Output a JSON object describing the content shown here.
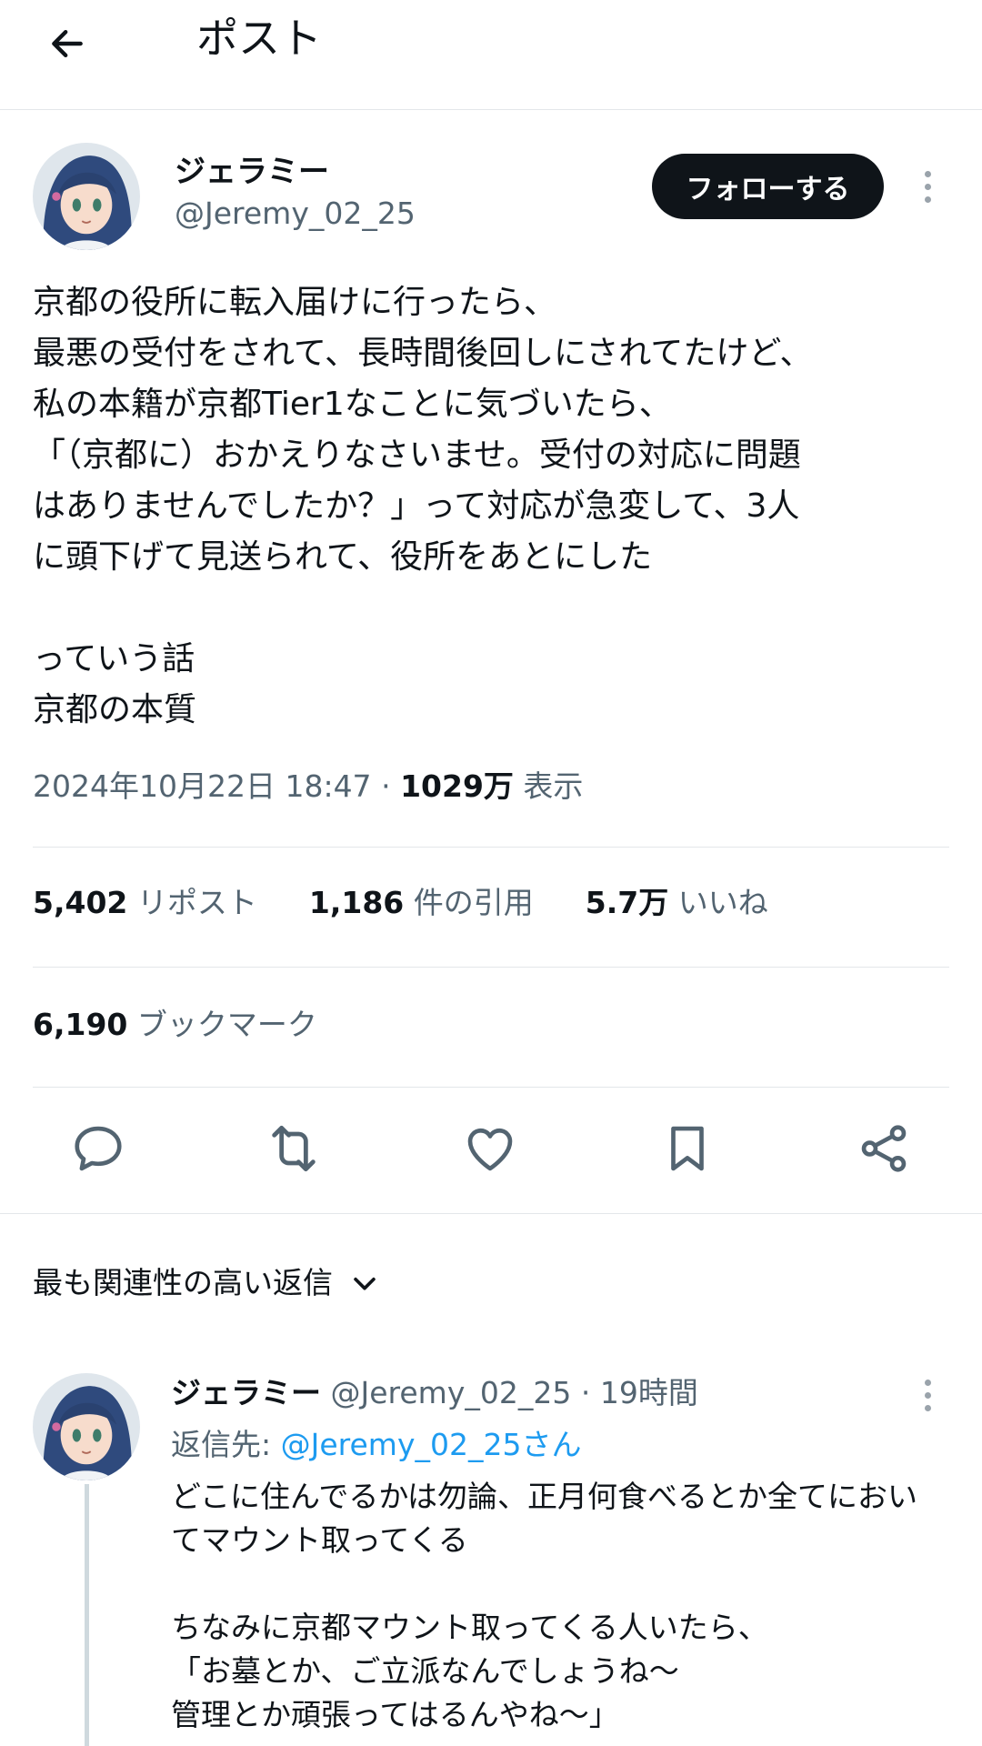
{
  "header": {
    "title": "ポスト",
    "back_icon": "arrow-left-icon"
  },
  "post": {
    "author": {
      "name": "ジェラミー",
      "handle": "@Jeremy_02_25"
    },
    "follow_label": "フォローする",
    "lines": [
      "京都の役所に転入届けに行ったら、",
      "最悪の受付をされて、長時間後回しにされてたけど、",
      "私の本籍が京都Tier1なことに気づいたら、",
      "「（京都に）おかえりなさいませ。受付の対応に問題",
      "はありませんでしたか？」って対応が急変して、3人",
      "に頭下げて見送られて、役所をあとにした",
      "",
      "っていう話",
      "京都の本質"
    ],
    "timestamp": "2024年10月22日 18:47",
    "separator": "·",
    "views_count": "1029万",
    "views_label": "表示",
    "stats": {
      "reposts": "5,402",
      "reposts_label": "リポスト",
      "quotes": "1,186",
      "quotes_label": "件の引用",
      "likes": "5.7万",
      "likes_label": "いいね",
      "bookmarks": "6,190",
      "bookmarks_label": "ブックマーク"
    },
    "actions": [
      "reply-icon",
      "repost-icon",
      "like-icon",
      "bookmark-icon",
      "share-icon"
    ]
  },
  "replies_sort": {
    "label": "最も関連性の高い返信"
  },
  "reply": {
    "name": "ジェラミー",
    "handle": "@Jeremy_02_25",
    "time": "· 19時間",
    "reply_to_label": "返信先:",
    "reply_to_user": "@Jeremy_02_25さん",
    "lines": [
      "どこに住んでるかは勿論、正月何食べるとか全てにおい",
      "てマウント取ってくる",
      "",
      "ちなみに京都マウント取ってくる人いたら、",
      "「お墓とか、ご立派なんでしょうね〜",
      "管理とか頑張ってはるんやね〜」"
    ]
  },
  "colors": {
    "text": "#0f1419",
    "secondary": "#536471",
    "accent": "#1d9bf0",
    "border": "#e3e7ea"
  }
}
